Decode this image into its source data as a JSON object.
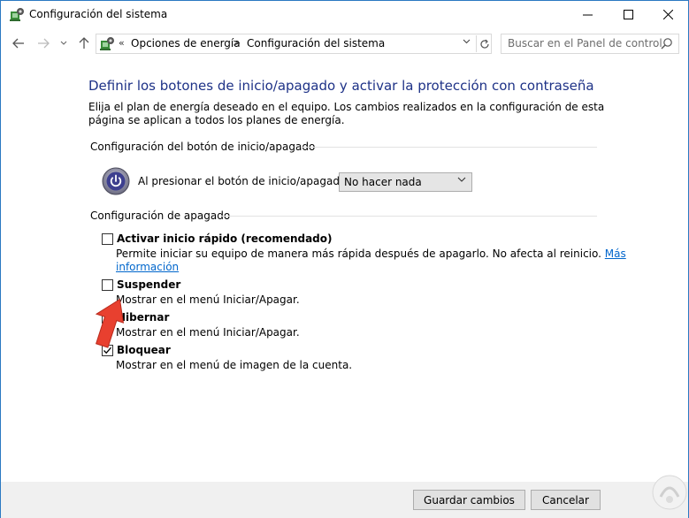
{
  "window": {
    "title": "Configuración del sistema",
    "controls": {
      "minimize": "—",
      "maximize": "☐",
      "close": "✕"
    }
  },
  "address_bar": {
    "prefix_chevron": "«",
    "crumbs": [
      "Opciones de energía",
      "Configuración del sistema"
    ],
    "separator": ">",
    "search_placeholder": "Buscar en el Panel de control"
  },
  "page": {
    "title": "Definir los botones de inicio/apagado y activar la protección con contraseña",
    "description": "Elija el plan de energía deseado en el equipo. Los cambios realizados en la configuración de esta página se aplican a todos los planes de energía."
  },
  "power_button_section": {
    "label": "Configuración del botón de inicio/apagado",
    "power_label": "Al presionar el botón de inicio/apagado:",
    "selected_action": "No hacer nada"
  },
  "shutdown_section": {
    "label": "Configuración de apagado",
    "options": [
      {
        "label": "Activar inicio rápido (recomendado)",
        "description": "Permite iniciar su equipo de manera más rápida después de apagarlo. No afecta al reinicio.",
        "link_part1": "Más",
        "link_part2": "información",
        "checked": false
      },
      {
        "label": "Suspender",
        "description": "Mostrar en el menú Iniciar/Apagar.",
        "checked": false
      },
      {
        "label": "Hibernar",
        "description": "Mostrar en el menú Iniciar/Apagar.",
        "checked": false
      },
      {
        "label": "Bloquear",
        "description": "Mostrar en el menú de imagen de la cuenta.",
        "checked": true
      }
    ]
  },
  "footer": {
    "save_label": "Guardar cambios",
    "cancel_label": "Cancelar"
  },
  "colors": {
    "title_blue": "#1e3287",
    "link_blue": "#0066cc",
    "arrow_red": "#e8402f",
    "window_border": "#2b79c2"
  }
}
